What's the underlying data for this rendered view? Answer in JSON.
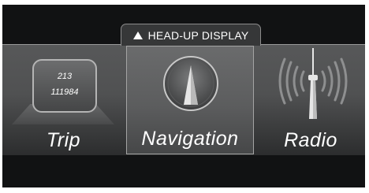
{
  "hud_tab": {
    "label": "HEAD-UP DISPLAY"
  },
  "menu": {
    "trip": {
      "label": "Trip",
      "odometer_line1": "213",
      "odometer_line2": "111984"
    },
    "navigation": {
      "label": "Navigation"
    },
    "radio": {
      "label": "Radio"
    }
  }
}
